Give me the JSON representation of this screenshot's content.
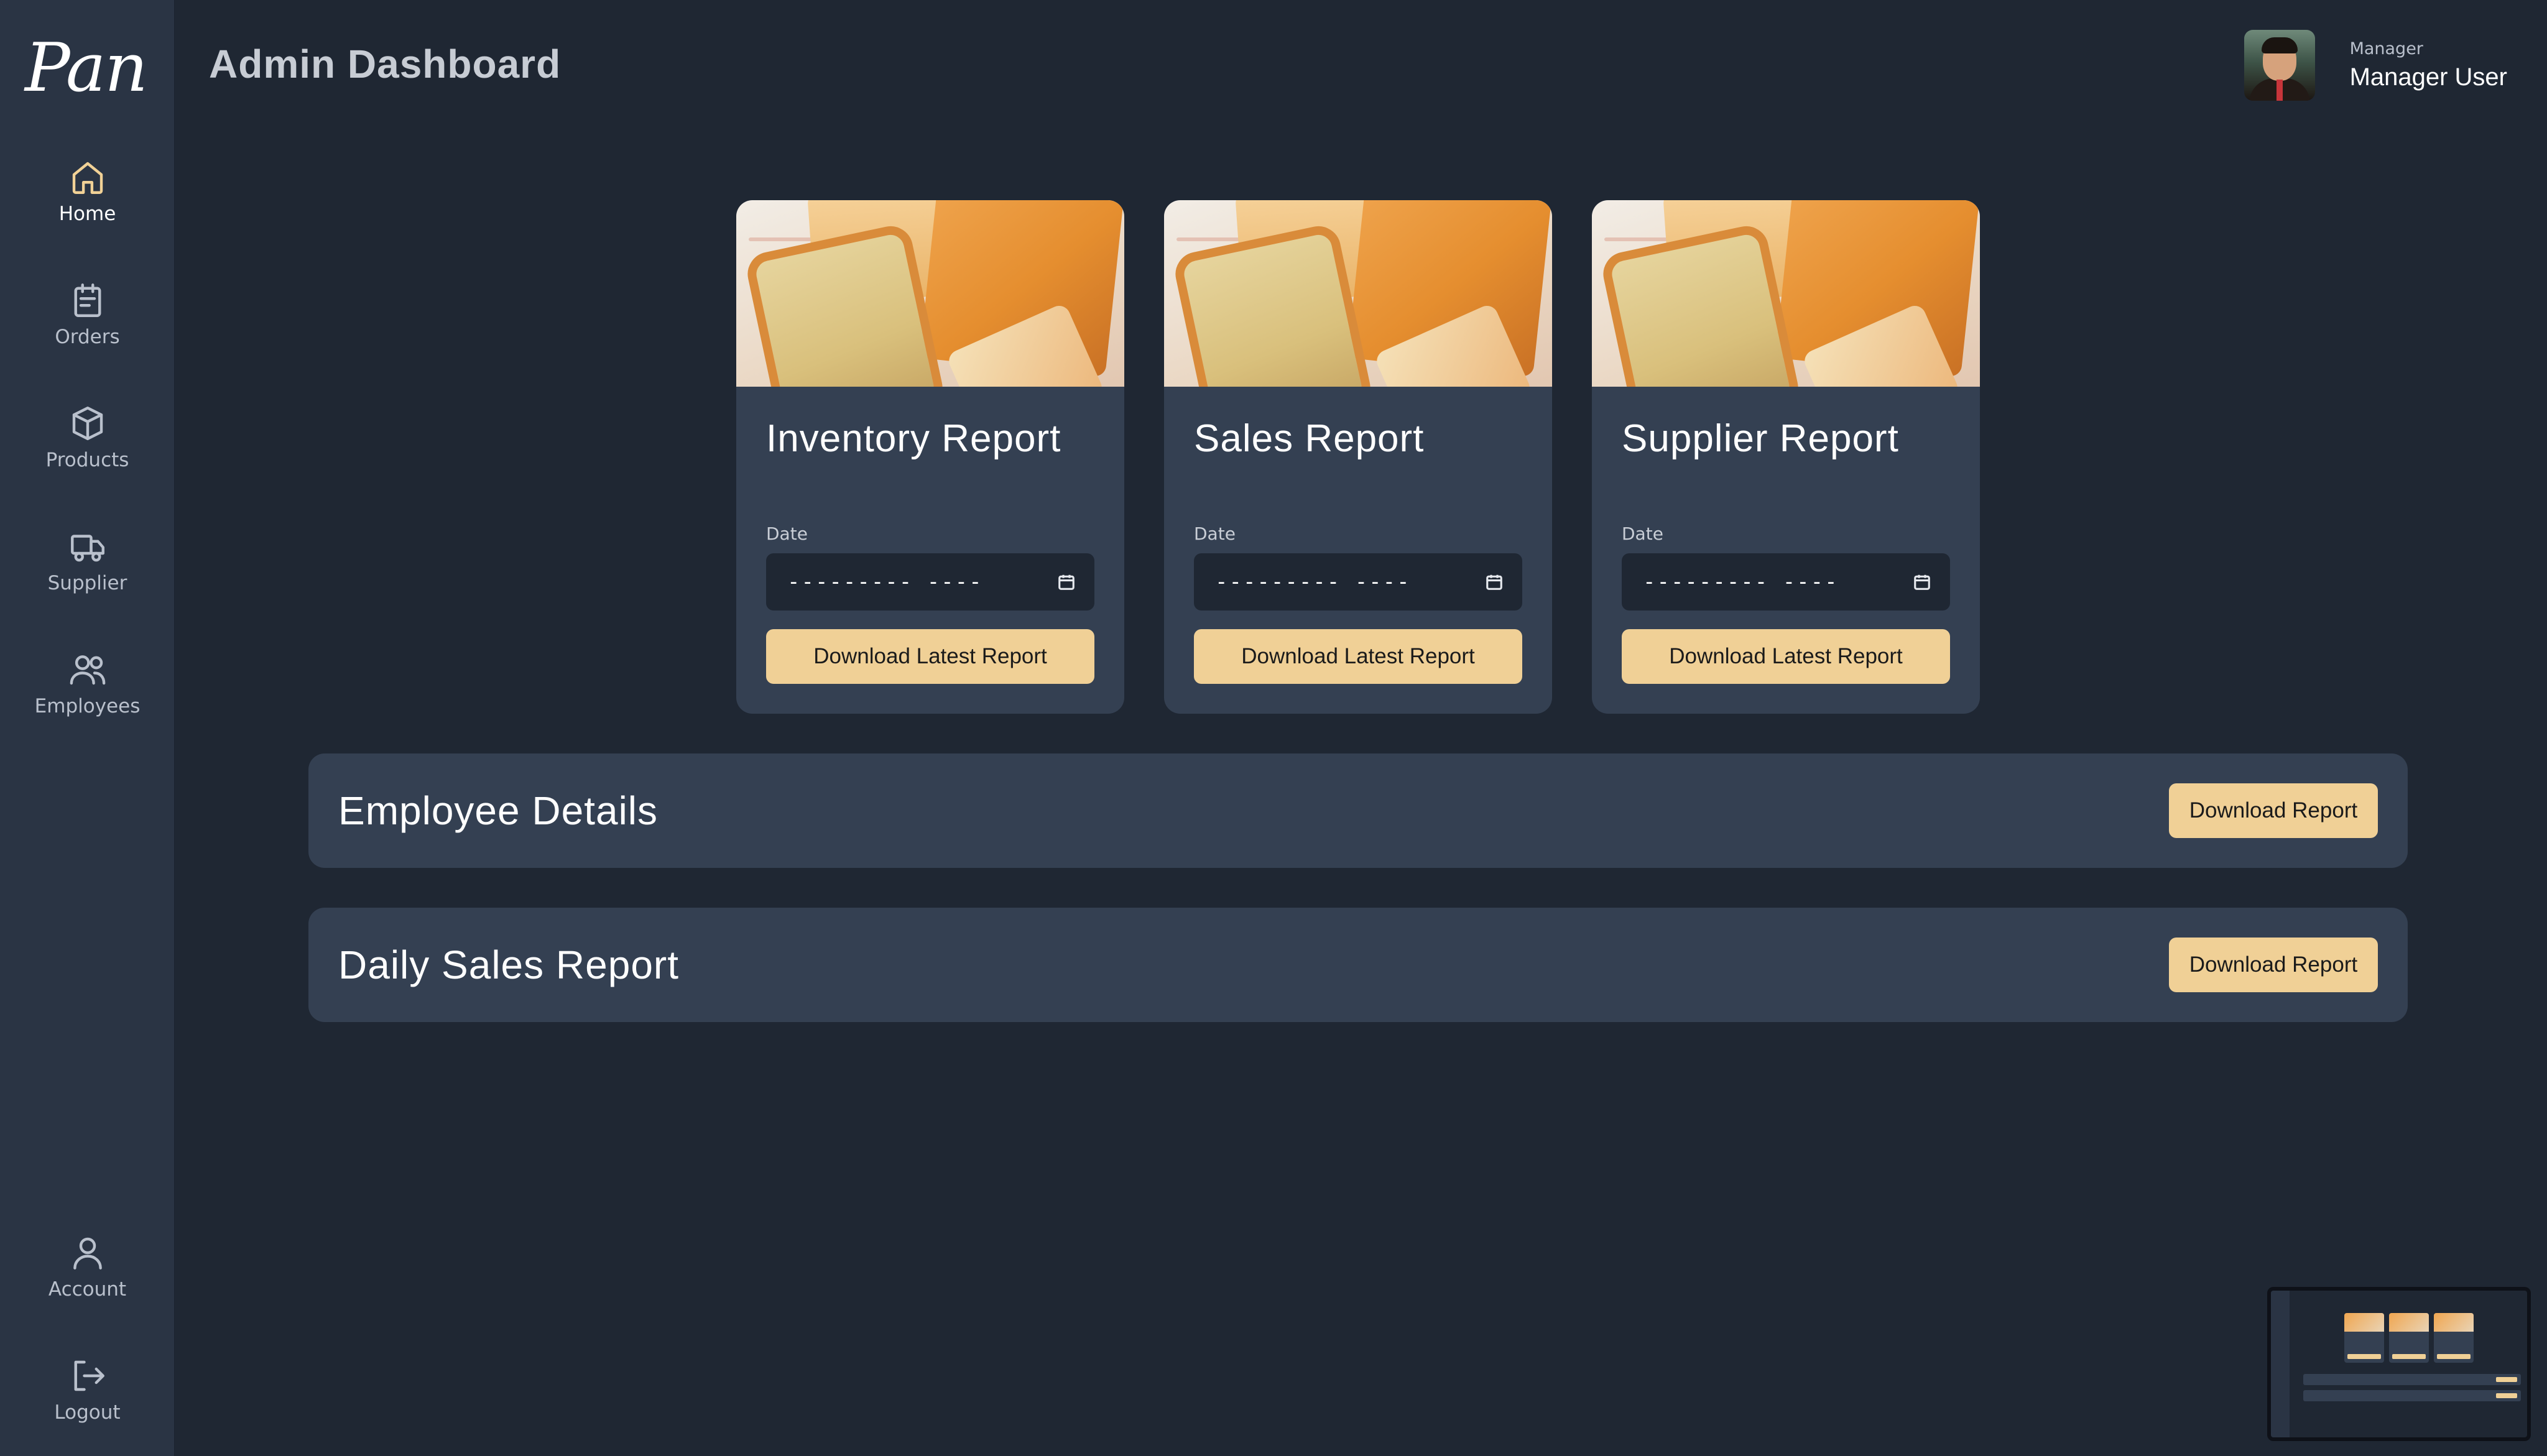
{
  "app": {
    "logo_text": "Pan",
    "page_title": "Admin Dashboard"
  },
  "user": {
    "role": "Manager",
    "name": "Manager User"
  },
  "sidebar": {
    "items": [
      {
        "label": "Home",
        "icon": "home-icon",
        "active": true
      },
      {
        "label": "Orders",
        "icon": "clipboard-icon",
        "active": false
      },
      {
        "label": "Products",
        "icon": "box-icon",
        "active": false
      },
      {
        "label": "Supplier",
        "icon": "truck-icon",
        "active": false
      },
      {
        "label": "Employees",
        "icon": "users-icon",
        "active": false
      }
    ],
    "bottom_items": [
      {
        "label": "Account",
        "icon": "user-icon"
      },
      {
        "label": "Logout",
        "icon": "logout-icon"
      }
    ]
  },
  "report_cards": [
    {
      "title": "Inventory Report",
      "date_label": "Date",
      "date_value": "--------- ----",
      "button_label": "Download Latest Report"
    },
    {
      "title": "Sales Report",
      "date_label": "Date",
      "date_value": "--------- ----",
      "button_label": "Download Latest Report"
    },
    {
      "title": "Supplier Report",
      "date_label": "Date",
      "date_value": "--------- ----",
      "button_label": "Download Latest Report"
    }
  ],
  "report_bars": [
    {
      "title": "Employee Details",
      "button_label": "Download Report"
    },
    {
      "title": "Daily Sales Report",
      "button_label": "Download Report"
    }
  ],
  "colors": {
    "background": "#1f2733",
    "panel": "#344052",
    "sidebar": "#2a3444",
    "accent_button": "#f0d096",
    "active_icon": "#f1d196"
  }
}
